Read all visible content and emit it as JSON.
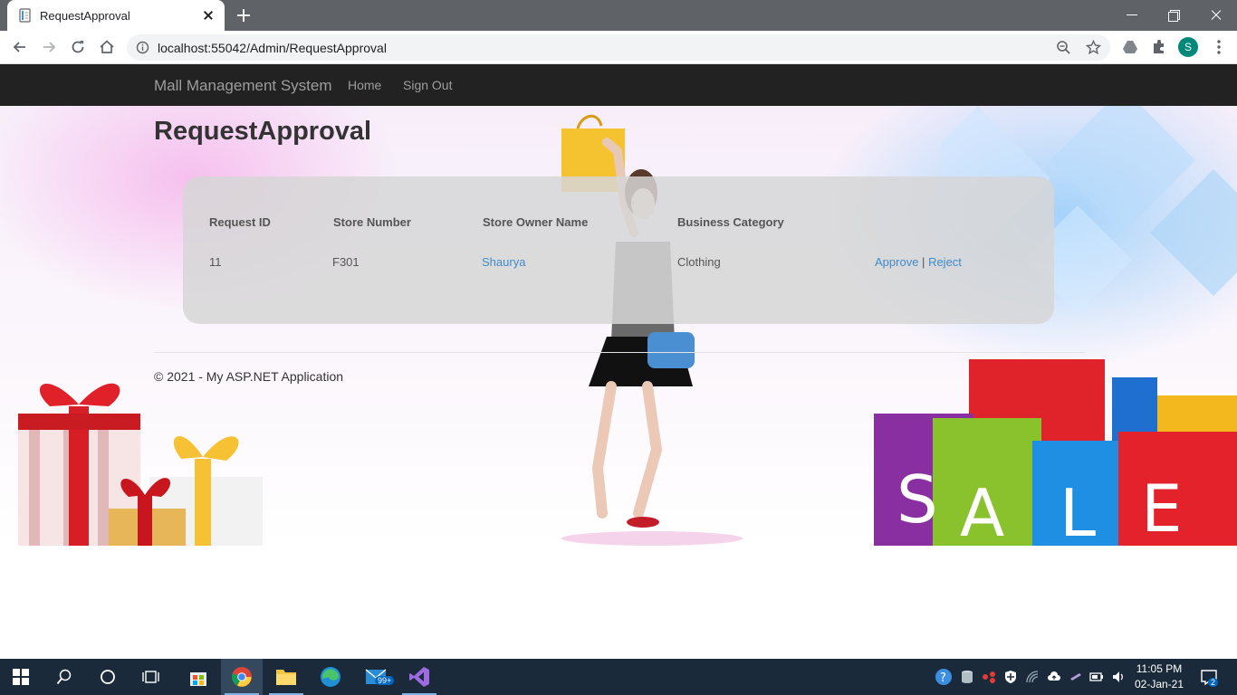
{
  "browser": {
    "tab_title": "RequestApproval",
    "url": "localhost:55042/Admin/RequestApproval",
    "profile_initial": "S"
  },
  "navbar": {
    "brand": "Mall Management System",
    "links": [
      "Home",
      "Sign Out"
    ]
  },
  "page": {
    "title": "RequestApproval",
    "table": {
      "headers": [
        "Request ID",
        "Store Number",
        "Store Owner Name",
        "Business Category"
      ],
      "rows": [
        {
          "request_id": "11",
          "store_number": "F301",
          "owner_name": "Shaurya",
          "business_category": "Clothing",
          "approve": "Approve",
          "separator": "|",
          "reject": "Reject"
        }
      ]
    },
    "footer": "© 2021 - My ASP.NET Application",
    "decoration_letters": [
      "S",
      "A",
      "L",
      "E"
    ]
  },
  "taskbar": {
    "mail_badge": "99+",
    "notification_count": "2",
    "time": "11:05 PM",
    "date": "02-Jan-21"
  },
  "colors": {
    "navbar": "#222222",
    "link": "#428bca",
    "taskbar": "#1b2a3b",
    "tabstrip": "#5f6368"
  }
}
